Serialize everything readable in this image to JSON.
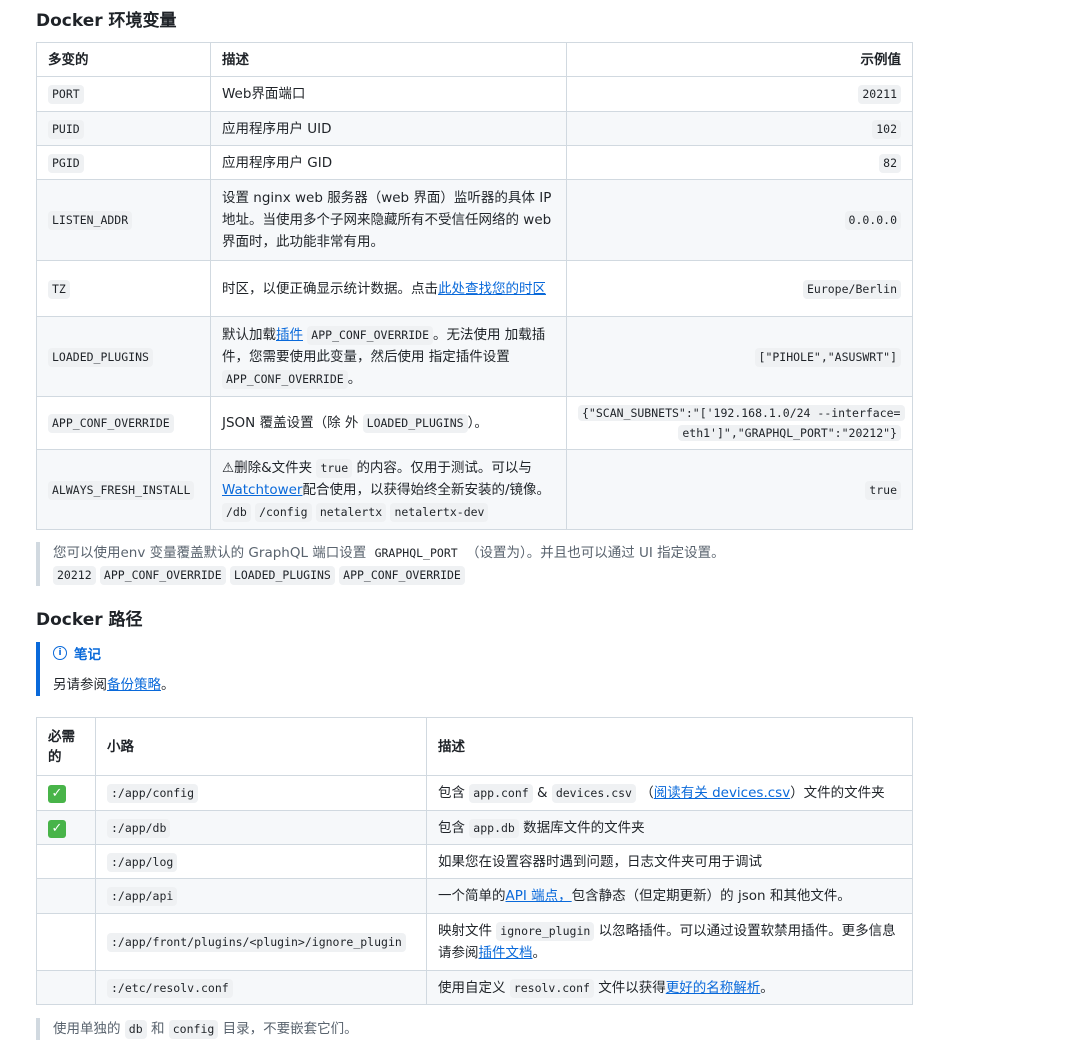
{
  "env_section": {
    "heading": "Docker 环境变量",
    "headers": [
      "多变的",
      "描述",
      "示例值"
    ],
    "rows": [
      {
        "var": "PORT",
        "desc": "Web界面端口",
        "example": "20211"
      },
      {
        "var": "PUID",
        "desc": "应用程序用户 UID",
        "example": "102"
      },
      {
        "var": "PGID",
        "desc": "应用程序用户 GID",
        "example": "82"
      },
      {
        "var": "LISTEN_ADDR",
        "desc": "设置 nginx web 服务器（web 界面）监听器的具体 IP 地址。当使用多个子网来隐藏所有不受信任网络的 web 界面时，此功能非常有用。",
        "example": "0.0.0.0"
      },
      {
        "var": "TZ",
        "desc_pre": "时区，以便正确显示统计数据。点击",
        "desc_link": "此处查找您的时区",
        "example": "Europe/Berlin"
      },
      {
        "var": "LOADED_PLUGINS",
        "desc_a": "默认加载",
        "desc_link": "插件",
        "desc_code1": "APP_CONF_OVERRIDE",
        "desc_b": "。无法使用 加载插件，您需要使用此变量，然后使用 指定插件设置",
        "desc_code2": "APP_CONF_OVERRIDE",
        "desc_c": "。",
        "example": "[\"PIHOLE\",\"ASUSWRT\"]"
      },
      {
        "var": "APP_CONF_OVERRIDE",
        "desc_a": "JSON 覆盖设置（除 外",
        "desc_code": "LOADED_PLUGINS",
        "desc_b": "）。",
        "example": "{\"SCAN_SUBNETS\":\"['192.168.1.0/24 --interface=eth1']\",\"GRAPHQL_PORT\":\"20212\"}"
      },
      {
        "var": "ALWAYS_FRESH_INSTALL",
        "desc_a": "⚠删除&文件夹",
        "desc_code1": "true",
        "desc_b": "的内容。仅用于测试。可以与",
        "desc_link": "Watchtower",
        "desc_c": "配合使用，以获得始终全新安装的/镜像。",
        "desc_code2": "/db",
        "desc_code3": "/config",
        "desc_code4": "netalertx",
        "desc_code5": "netalertx-dev",
        "example": "true"
      }
    ]
  },
  "env_quote": {
    "line1_a": "您可以使用env 变量覆盖默认的 GraphQL 端口设置",
    "line1_code": "GRAPHQL_PORT",
    "line1_b": "（设置为）。并且也可以通过 UI 指定设置。",
    "line2_codes": [
      "20212",
      "APP_CONF_OVERRIDE",
      "LOADED_PLUGINS",
      "APP_CONF_OVERRIDE"
    ]
  },
  "path_section": {
    "heading": "Docker 路径",
    "note_title": "笔记",
    "note_text": "另请参阅",
    "note_link": "备份策略",
    "note_end": "。",
    "headers": [
      "必需的",
      "小路",
      "描述"
    ],
    "rows": [
      {
        "required": true,
        "path": ":/app/config",
        "desc_a": "包含",
        "desc_code1": "app.conf",
        "desc_b": "&",
        "desc_code2": "devices.csv",
        "desc_c": "（",
        "desc_link": "阅读有关 devices.csv",
        "desc_d": "）文件的文件夹"
      },
      {
        "required": true,
        "path": ":/app/db",
        "desc_a": "包含",
        "desc_code1": "app.db",
        "desc_b": "数据库文件的文件夹"
      },
      {
        "required": false,
        "path": ":/app/log",
        "desc_a": "如果您在设置容器时遇到问题，日志文件夹可用于调试"
      },
      {
        "required": false,
        "path": ":/app/api",
        "desc_a": "一个简单的",
        "desc_link": "API 端点，",
        "desc_b": "包含静态（但定期更新）的 json 和其他文件。"
      },
      {
        "required": false,
        "path": ":/app/front/plugins/<plugin>/ignore_plugin",
        "desc_a": "映射文件",
        "desc_code1": "ignore_plugin",
        "desc_b": "以忽略插件。可以通过设置软禁用插件。更多信息请参阅",
        "desc_link": "插件文档",
        "desc_c": "。"
      },
      {
        "required": false,
        "path": ":/etc/resolv.conf",
        "desc_a": "使用自定义",
        "desc_code1": "resolv.conf",
        "desc_b": "文件以获得",
        "desc_link": "更好的名称解析",
        "desc_c": "。"
      }
    ]
  },
  "path_quote": {
    "text_a": "使用单独的",
    "code1": "db",
    "text_b": "和",
    "code2": "config",
    "text_c": "目录，不要嵌套它们。"
  }
}
